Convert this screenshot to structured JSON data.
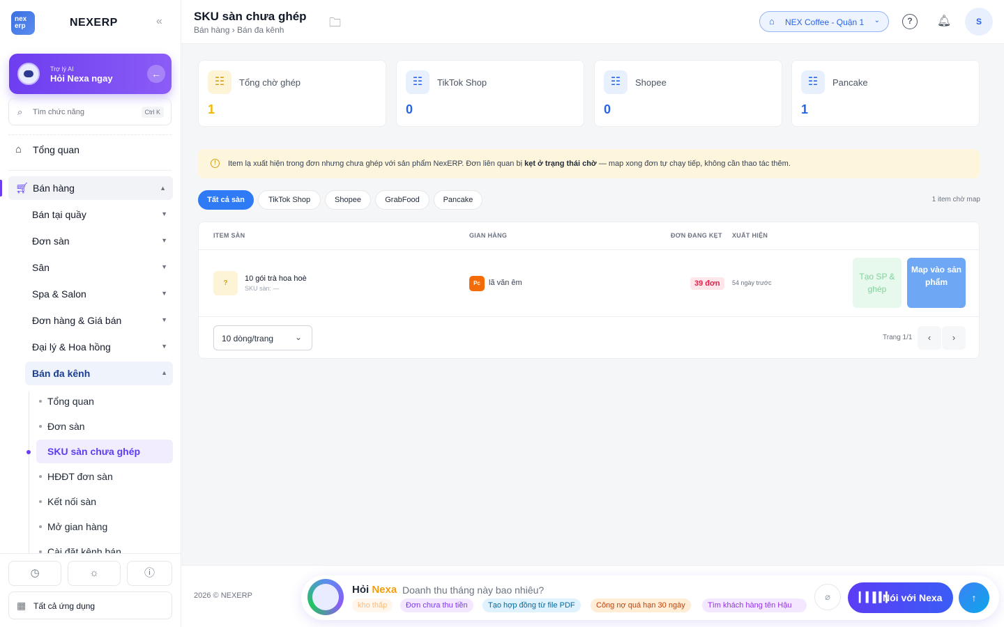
{
  "brand": {
    "logo_text": "nex erp",
    "name": "NEXERP",
    "collapse_icon": "«"
  },
  "ai_card": {
    "small": "Trợ lý AI",
    "title": "Hỏi Nexa ngay"
  },
  "search": {
    "placeholder": "Tìm chức năng",
    "shortcut": "Ctrl K"
  },
  "nav": {
    "overview": "Tổng quan",
    "sales": "Bán hàng",
    "sales_children": [
      "Bán tại quầy",
      "Đơn sàn",
      "Sân",
      "Spa & Salon",
      "Đơn hàng & Giá bán",
      "Đại lý & Hoa hồng",
      "Bán đa kênh"
    ],
    "multichannel_children": [
      "Tổng quan",
      "Đơn sàn",
      "SKU sàn chưa ghép",
      "HĐĐT đơn sàn",
      "Kết nối sàn",
      "Mở gian hàng",
      "Cài đặt kênh bán"
    ],
    "all_apps": "Tất cả ứng dụng"
  },
  "header": {
    "title": "SKU sàn chưa ghép",
    "breadcrumb": "Bán hàng › Bán đa kênh",
    "store": "NEX Coffee - Quận 1",
    "avatar": "S"
  },
  "stats": [
    {
      "label": "Tổng chờ ghép",
      "value": "1",
      "color": "#f5b800",
      "bg": "#fdf3d7"
    },
    {
      "label": "TikTok Shop",
      "value": "0",
      "color": "#2563eb",
      "bg": "#e8f0fe"
    },
    {
      "label": "Shopee",
      "value": "0",
      "color": "#2563eb",
      "bg": "#e8f0fe"
    },
    {
      "label": "Pancake",
      "value": "1",
      "color": "#2563eb",
      "bg": "#e8f0fe"
    }
  ],
  "notice": {
    "before": "Item lạ xuất hiện trong đơn nhưng chưa ghép với sản phẩm NexERP. Đơn liên quan bị ",
    "bold": "kẹt ở trạng thái chờ",
    "after": " — map xong đơn tự chạy tiếp, không cần thao tác thêm."
  },
  "filters": [
    "Tất cả sàn",
    "TikTok Shop",
    "Shopee",
    "GrabFood",
    "Pancake"
  ],
  "waiting_count": "1 item chờ map",
  "table": {
    "headers": [
      "ITEM SÀN",
      "GIAN HÀNG",
      "ĐƠN ĐANG KẸT",
      "XUẤT HIỆN"
    ],
    "row": {
      "thumb": "?",
      "name": "10 gói trà hoa hoè",
      "sku": "SKU sàn: —",
      "shop_badge": "Pc",
      "shop": "lã văn êm",
      "orders": "39 đơn",
      "appeared": "54 ngày trước",
      "create_btn": "Tạo SP & ghép",
      "map_btn": "Map vào sản phẩm"
    },
    "page_size": "10 dòng/trang",
    "page_info": "Trang 1/1"
  },
  "footer": {
    "copyright": "2026 © NEXERP",
    "ask_title": "Hỏi",
    "ask_title_accent": "Nexa",
    "ask_placeholder": "Doanh thu tháng này bao nhiêu?",
    "suggestions": [
      "kho thấp",
      "Đơn chưa thu tiền",
      "Tạo hợp đồng từ file PDF",
      "Công nợ quá hạn 30 ngày",
      "Tìm khách hàng tên Hậu"
    ],
    "voice_btn": "Nói với Nexa"
  }
}
